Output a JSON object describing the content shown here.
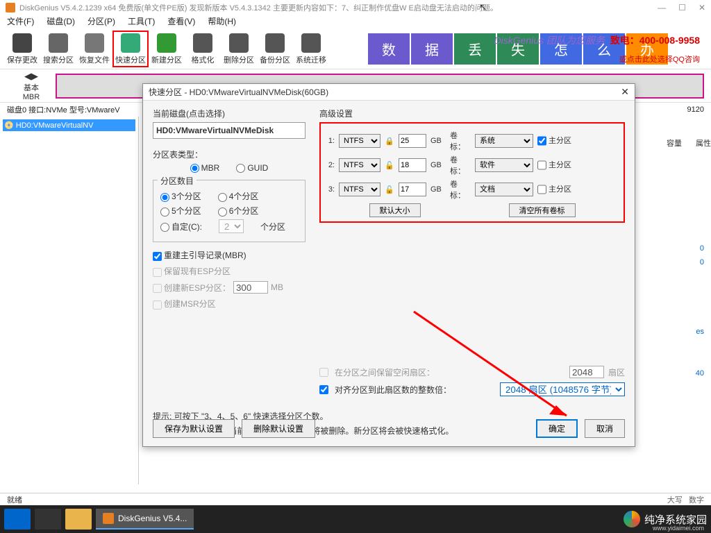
{
  "title": "DiskGenius V5.4.2.1239 x64 免费版(单文件PE版)   发现新版本 V5.4.3.1342   主要更新内容如下：7、纠正制作优盘W   E启动盘无法启动的问题。",
  "menus": [
    "文件(F)",
    "磁盘(D)",
    "分区(P)",
    "工具(T)",
    "查看(V)",
    "帮助(H)"
  ],
  "tools": [
    "保存更改",
    "搜索分区",
    "恢复文件",
    "快速分区",
    "新建分区",
    "格式化",
    "删除分区",
    "备份分区",
    "系统迁移"
  ],
  "bannerChars": [
    "数",
    "据",
    "丢",
    "失",
    "怎",
    "么",
    "办"
  ],
  "bannerTeam": "DiskGenius 团队为您服务",
  "bannerPhone": "致电：400-008-9958",
  "bannerQQ": "或点击此处选择QQ咨询",
  "basic": "基本",
  "mbr": "MBR",
  "diskinfo": "磁盘0 接口:NVMe 型号:VMwareV",
  "diskinfoR": "9120",
  "treeItem": "HD0:VMwareVirtualNV",
  "gridCols": [
    "容量",
    "属性"
  ],
  "rightNums": [
    "0",
    "0",
    "es",
    "40"
  ],
  "status": "就绪",
  "statusR1": "大写",
  "statusR2": "数字",
  "taskbarApp": "DiskGenius V5.4...",
  "brand": "纯净系统家园",
  "brandUrl": "www.yidaimei.com",
  "dialog": {
    "title": "快速分区 - HD0:VMwareVirtualNVMeDisk(60GB)",
    "curDisk": "当前磁盘(点击选择)",
    "diskName": "HD0:VMwareVirtualNVMeDisk",
    "ptLabel": "分区表类型：",
    "ptMBR": "MBR",
    "ptGUID": "GUID",
    "pcLabel": "分区数目",
    "pc3": "3个分区",
    "pc4": "4个分区",
    "pc5": "5个分区",
    "pc6": "6个分区",
    "pcCustom": "自定(C):",
    "pcCustomVal": "2",
    "pcUnit": "个分区",
    "rebuild": "重建主引导记录(MBR)",
    "keepESP": "保留现有ESP分区",
    "newESP": "创建新ESP分区：",
    "newESPval": "300",
    "mb": "MB",
    "newMSR": "创建MSR分区",
    "advLabel": "高级设置",
    "rows": [
      {
        "n": "1:",
        "fs": "NTFS",
        "sz": "25",
        "vl": "系统",
        "pri": true,
        "lock": "🔒"
      },
      {
        "n": "2:",
        "fs": "NTFS",
        "sz": "18",
        "vl": "软件",
        "pri": false,
        "lock": "🔓"
      },
      {
        "n": "3:",
        "fs": "NTFS",
        "sz": "17",
        "vl": "文档",
        "pri": false,
        "lock": "🔓"
      }
    ],
    "gb": "GB",
    "vlTxt": "卷标：",
    "priTxt": "主分区",
    "defSize": "默认大小",
    "clrLabel": "清空所有卷标",
    "gap": "在分区之间保留空闲扇区：",
    "gapVal": "2048",
    "gapUnit": "扇区",
    "align": "对齐分区到此扇区数的整数倍：",
    "alignVal": "2048 扇区 (1048576 字节)",
    "hint1": "提示: 可按下 \"3、4、5、6\" 快速选择分区个数。",
    "hint2": "注意: 此功能执行后, 当前磁盘上的现有分区将被删除。新分区将会被快速格式化。",
    "saveDef": "保存为默认设置",
    "delDef": "删除默认设置",
    "ok": "确定",
    "cancel": "取消"
  }
}
